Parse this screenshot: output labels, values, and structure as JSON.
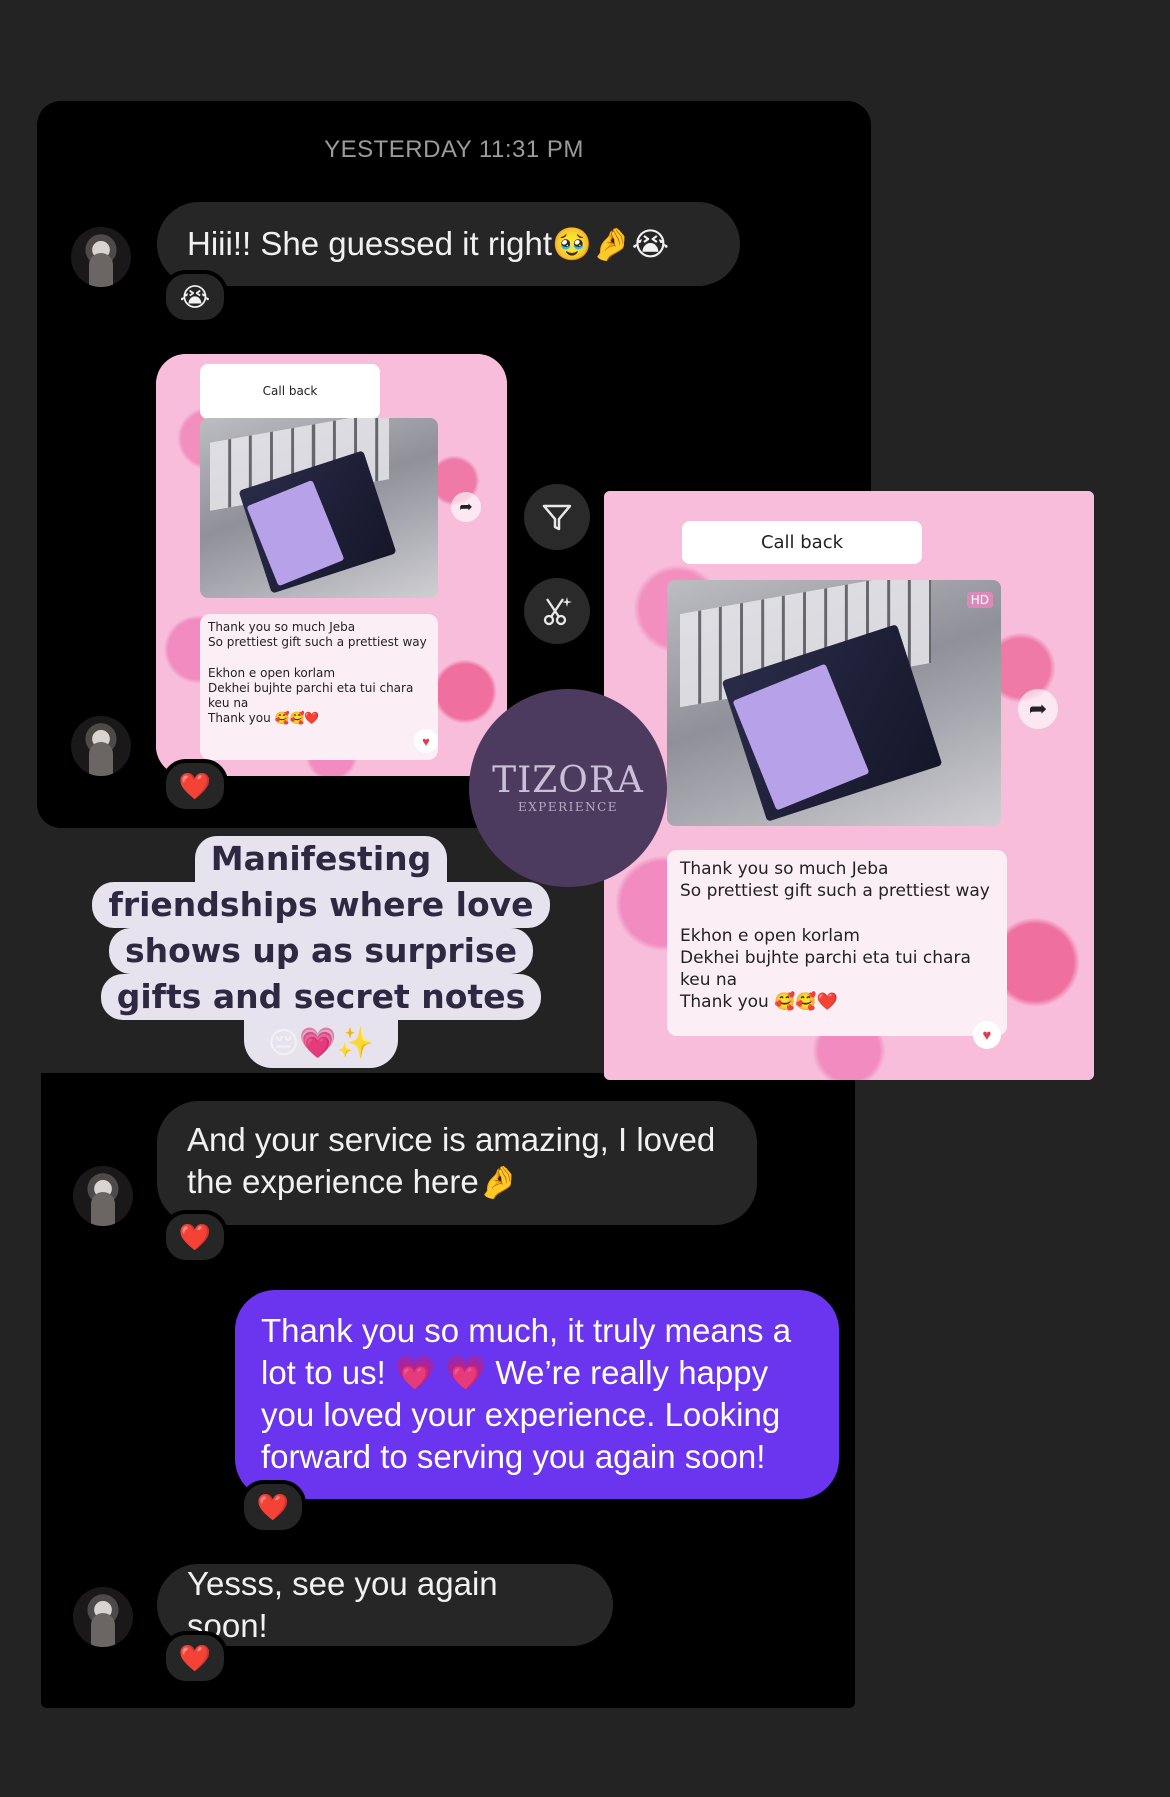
{
  "timestamp": "YESTERDAY 11:31 PM",
  "messages": [
    {
      "text": "Hiii!! She guessed it right",
      "emojis": "🥹🤌😭",
      "reaction": "😭"
    },
    {
      "text": "And your service is amazing, I loved the experience here",
      "emojis": "🤌",
      "reaction": "❤️"
    },
    {
      "text": "Thank you so much, it truly means a lot to us! 💗 💗 We’re really happy you loved your experience. Looking forward to serving you again soon!",
      "reaction": "❤️"
    },
    {
      "text": "Yesss, see you again soon!",
      "reaction": "❤️"
    }
  ],
  "shared_image": {
    "call_back_label": "Call back",
    "chat_text_1": "Thank you so much Jeba\nSo prettiest gift such a prettiest way",
    "chat_text_2": "Ekhon e open korlam\nDekhei bujhte parchi eta tui chara\nkeu na\nThank you 🥰🥰❤️",
    "hd_badge": "HD",
    "reaction": "❤️"
  },
  "logo": {
    "name": "TIZORA",
    "sub": "EXPERIENCE"
  },
  "caption": {
    "lines": [
      "Manifesting",
      "friendships where love",
      "shows up as surprise",
      "gifts and secret notes"
    ],
    "emojis": "😔💗✨"
  },
  "icons": [
    "filter-icon",
    "sparkle-cut-icon",
    "forward-icon",
    "heart-icon"
  ],
  "colors": {
    "background": "#232323",
    "panel": "#000000",
    "bubble_in": "#262626",
    "bubble_out": "#6b34ee",
    "logo_circle": "#4c3a5f",
    "caption_bg": "#e7e3ee"
  }
}
